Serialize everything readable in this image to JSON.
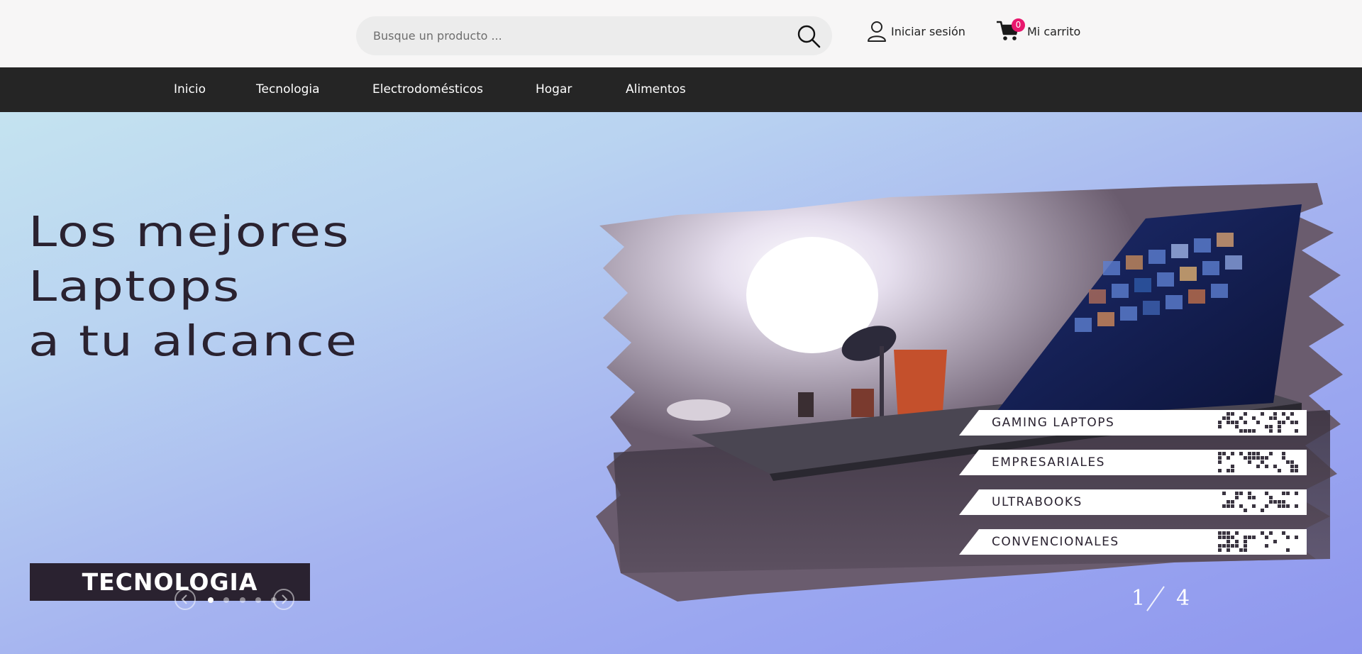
{
  "header": {
    "search": {
      "placeholder": "Busque un producto ...",
      "value": ""
    },
    "login_label": "Iniciar sesión",
    "cart": {
      "label": "Mi carrito",
      "count": "0"
    }
  },
  "nav": {
    "items": [
      {
        "label": "Inicio"
      },
      {
        "label": "Tecnologia"
      },
      {
        "label": "Electrodomésticos"
      },
      {
        "label": "Hogar"
      },
      {
        "label": "Alimentos"
      }
    ]
  },
  "hero": {
    "headline": [
      "Los mejores",
      "Laptops",
      "a tu alcance"
    ],
    "badge": "TECNOLOGIA",
    "categories": [
      "GAMING LAPTOPS",
      "EMPRESARIALES",
      "ULTRABOOKS",
      "CONVENCIONALES"
    ],
    "slider": {
      "current": "1",
      "total": "4",
      "dots": 5,
      "active_dot": 0
    }
  },
  "colors": {
    "navbar": "#252525",
    "cart_badge": "#e8176d",
    "headline": "#2a2230"
  }
}
